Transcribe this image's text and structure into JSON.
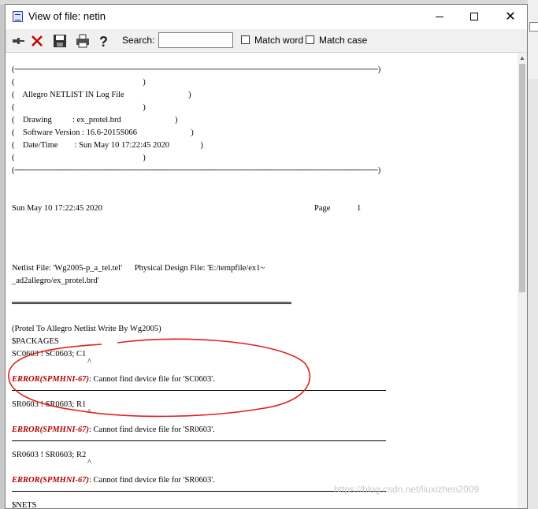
{
  "window": {
    "title": "View of file: netin"
  },
  "toolbar": {
    "search_label": "Search:",
    "search_value": "",
    "match_word": "Match word",
    "match_case": "Match case"
  },
  "log": {
    "header_lines": [
      "(──────────────────────────────────────────────────────────────)",
      "(                                                              )",
      "(    Allegro NETLIST IN Log File                               )",
      "(                                                              )",
      "(    Drawing          : ex_protel.brd                          )",
      "(    Software Version : 16.6-2015S066                          )",
      "(    Date/Time        : Sun May 10 17:22:45 2020               )",
      "(                                                              )",
      "(──────────────────────────────────────────────────────────────)"
    ],
    "date_line": "Sun May 10 17:22:45 2020",
    "page_label": "Page",
    "page_number": "1",
    "netlist_line1": "Netlist File: 'Wg2005-p_a_tel.tel'      Physical Design File: 'E:/tempfile/ex1~",
    "netlist_line2": "_ad2allegro/ex_protel.brd'",
    "protel_line": "(Protel To Allegro Netlist Write By Wg2005)",
    "packages_label": "$PACKAGES",
    "entries": [
      {
        "package": "SC0603 ! SC0603; C1",
        "caret": "^",
        "error_code": "ERROR(SPMHNI-67)",
        "message": ": Cannot find device file for 'SC0603'."
      },
      {
        "package": "SR0603 ! SR0603; R1",
        "caret": "^",
        "error_code": "ERROR(SPMHNI-67)",
        "message": ": Cannot find device file for 'SR0603'."
      },
      {
        "package": "SR0603 ! SR0603; R2",
        "caret": "^",
        "error_code": "ERROR(SPMHNI-67)",
        "message": ": Cannot find device file for 'SR0603'."
      }
    ],
    "nets_label": "$NETS"
  },
  "watermark": "https://blog.csdn.net/liuxizhen2009",
  "colors": {
    "error": "#b00000",
    "annotation": "#e02020",
    "toolbar_bg": "#f0f0f0"
  }
}
